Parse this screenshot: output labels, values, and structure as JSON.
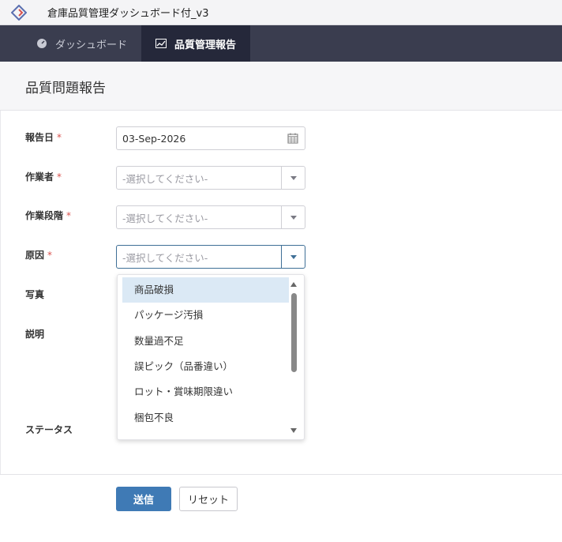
{
  "app": {
    "title": "倉庫品質管理ダッシュボード付_v3",
    "logo_icon": "diamond-logo-icon"
  },
  "nav": {
    "tabs": [
      {
        "label": "ダッシュボード",
        "icon": "gauge-icon",
        "active": false
      },
      {
        "label": "品質管理報告",
        "icon": "chart-icon",
        "active": true
      }
    ]
  },
  "page": {
    "title": "品質問題報告"
  },
  "form": {
    "required_mark": "*",
    "report_date": {
      "label": "報告日",
      "value": "03-Sep-2026"
    },
    "worker": {
      "label": "作業者",
      "placeholder": "-選択してください-"
    },
    "work_stage": {
      "label": "作業段階",
      "placeholder": "-選択してください-"
    },
    "cause": {
      "label": "原因",
      "placeholder": "-選択してください-",
      "options": [
        "商品破損",
        "パッケージ汚損",
        "数量過不足",
        "誤ピック（品番違い）",
        "ロット・賞味期限違い",
        "梱包不良"
      ],
      "highlighted_option": "商品破損"
    },
    "photo": {
      "label": "写真"
    },
    "description": {
      "label": "説明"
    },
    "status": {
      "label": "ステータス"
    }
  },
  "actions": {
    "submit": "送信",
    "reset": "リセット"
  },
  "colors": {
    "nav_bg": "#3a3d4f",
    "nav_active_bg": "#25283a",
    "primary": "#3f7ab5",
    "required": "#d9534f",
    "highlight": "#dbe9f5"
  }
}
